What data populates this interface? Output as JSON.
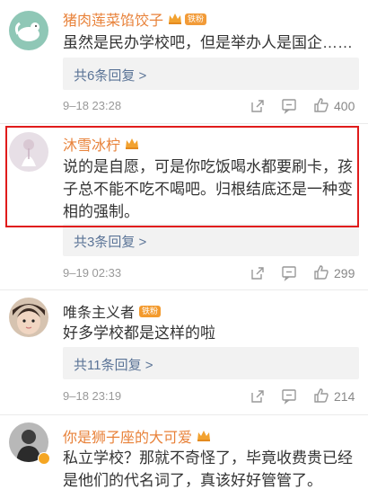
{
  "comments": [
    {
      "username": "猪肉莲菜馅饺子",
      "badge": "铁粉",
      "text": "虽然是民办学校吧，但是举办人是国企……",
      "reply_link": "共6条回复 >",
      "time": "9–18 23:28",
      "likes": "400"
    },
    {
      "username": "沐雪冰柠",
      "text": "说的是自愿，可是你吃饭喝水都要刷卡，孩子总不能不吃不喝吧。归根结底还是一种变相的强制。",
      "reply_link": "共3条回复 >",
      "time": "9–19 02:33",
      "likes": "299"
    },
    {
      "username": "唯条主义者",
      "badge": "铁粉",
      "text": "好多学校都是这样的啦",
      "reply_link": "共11条回复 >",
      "time": "9–18 23:19",
      "likes": "214"
    },
    {
      "username": "你是狮子座的大可爱",
      "text": "私立学校？那就不奇怪了，毕竟收费贵已经是他们的代名词了，真该好好管管了。"
    }
  ],
  "colors": {
    "highlight": "#e01b1b",
    "username_accent": "#e8823a",
    "reply_link": "#5b7497"
  },
  "icons": [
    "share-icon",
    "comment-icon",
    "like-icon",
    "crown-icon"
  ]
}
